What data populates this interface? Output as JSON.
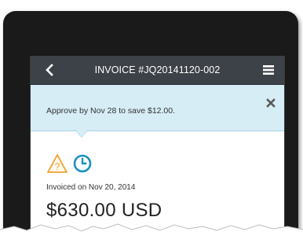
{
  "header": {
    "title": "INVOICE #JQ20141120-002",
    "back_icon": "chevron-left-icon",
    "menu_icon": "hamburger-menu-icon"
  },
  "banner": {
    "message": "Approve by Nov 28 to save $12.00.",
    "close_icon": "close-icon"
  },
  "status": {
    "icons": [
      "warning-icon",
      "clock-icon"
    ],
    "warning_color": "#f0a030",
    "clock_color": "#1a8fc4"
  },
  "invoice": {
    "invoiced_on": "Invoiced on Nov 20, 2014",
    "amount": "$630.00 USD"
  },
  "colors": {
    "nav_background": "#3d4248",
    "banner_background": "#d6edf6",
    "device_frame": "#1a1a1a"
  }
}
